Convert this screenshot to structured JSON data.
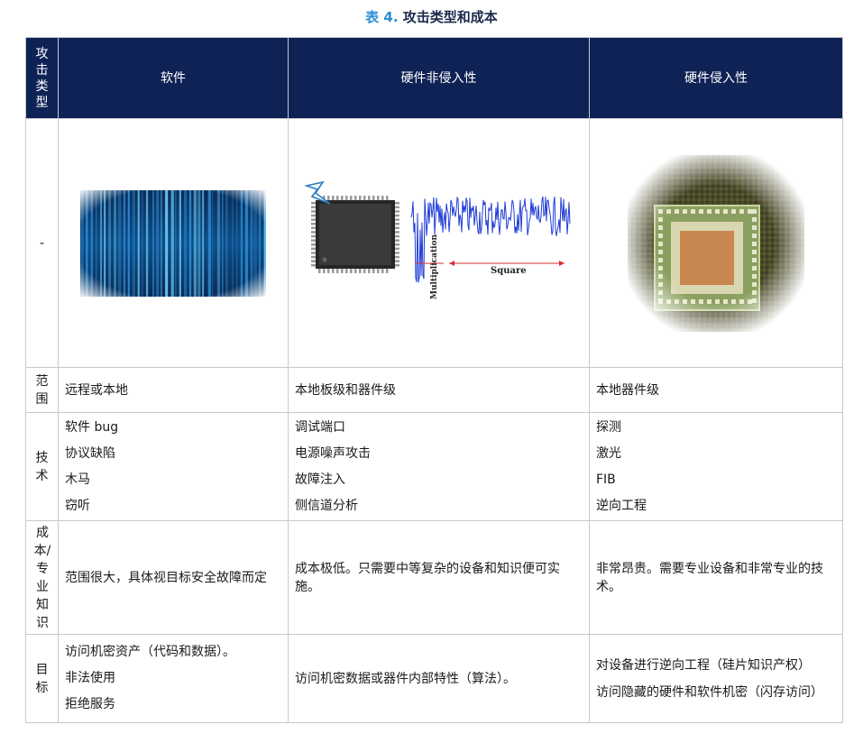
{
  "caption": {
    "label": "表",
    "number": "4.",
    "title": "攻击类型和成本"
  },
  "header": {
    "type": "攻击类型",
    "software": "软件",
    "hw_noninvasive": "硬件非侵入性",
    "hw_invasive": "硬件侵入性"
  },
  "image_row": {
    "label": "-",
    "plot_label_square": "Square",
    "plot_label_multiplication": "Multiplication"
  },
  "rows": {
    "scope": {
      "label": "范围",
      "software": "远程或本地",
      "noninvasive": "本地板级和器件级",
      "invasive": "本地器件级"
    },
    "techniques": {
      "label": "技术",
      "software": [
        "软件 bug",
        "协议缺陷",
        "木马",
        "窃听"
      ],
      "noninvasive": [
        "调试端口",
        "电源噪声攻击",
        "故障注入",
        "侧信道分析"
      ],
      "invasive": [
        "探测",
        "激光",
        "FIB",
        "逆向工程"
      ]
    },
    "cost": {
      "label": "成本/专业知识",
      "software": "范围很大，具体视目标安全故障而定",
      "noninvasive": "成本极低。只需要中等复杂的设备和知识便可实施。",
      "invasive": "非常昂贵。需要专业设备和非常专业的技术。"
    },
    "target": {
      "label": "目标",
      "software": [
        "访问机密资产（代码和数据）。",
        "非法使用",
        "拒绝服务"
      ],
      "noninvasive": "访问机密数据或器件内部特性（算法）。",
      "invasive": [
        "对设备进行逆向工程（硅片知识产权）",
        "访问隐藏的硬件和软件机密（闪存访问）"
      ]
    }
  }
}
